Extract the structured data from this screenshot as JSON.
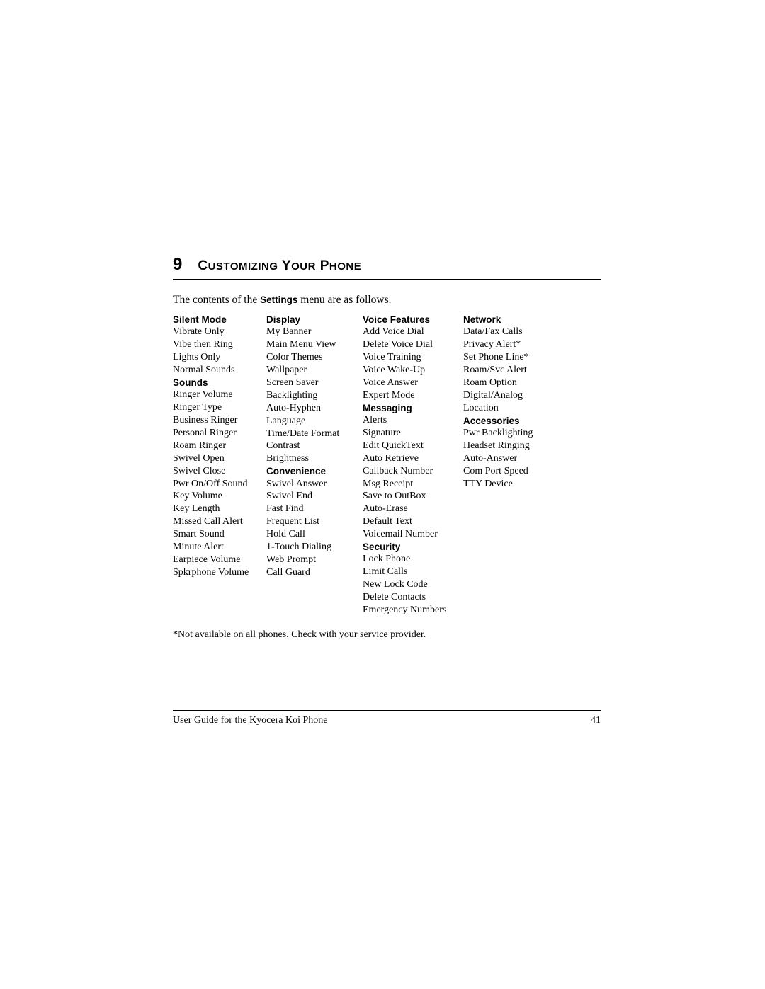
{
  "chapter": {
    "number": "9",
    "title_caps": [
      "C",
      "USTOMIZING",
      " Y",
      "OUR",
      " P",
      "HONE"
    ]
  },
  "intro": {
    "prefix": "The contents of the ",
    "bold": "Settings",
    "suffix": " menu are as follows."
  },
  "columns": [
    {
      "sections": [
        {
          "heading": "Silent Mode",
          "items": [
            "Vibrate Only",
            "Vibe then Ring",
            "Lights Only",
            "Normal Sounds"
          ]
        },
        {
          "heading": "Sounds",
          "items": [
            "Ringer Volume",
            "Ringer Type",
            "Business Ringer",
            "Personal Ringer",
            "Roam Ringer",
            "Swivel Open",
            "Swivel Close",
            "Pwr On/Off Sound",
            "Key Volume",
            "Key Length",
            "Missed Call Alert",
            "Smart Sound",
            "Minute Alert",
            "Earpiece Volume",
            "Spkrphone Volume"
          ]
        }
      ]
    },
    {
      "sections": [
        {
          "heading": "Display",
          "items": [
            "My Banner",
            "Main Menu View",
            "Color Themes",
            "Wallpaper",
            "Screen Saver",
            "Backlighting",
            "Auto-Hyphen",
            "Language",
            "Time/Date Format",
            "Contrast",
            "Brightness"
          ]
        },
        {
          "heading": "Convenience",
          "items": [
            "Swivel Answer",
            "Swivel End",
            "Fast Find",
            "Frequent List",
            "Hold Call",
            "1-Touch Dialing",
            "Web Prompt",
            "Call Guard"
          ]
        }
      ]
    },
    {
      "sections": [
        {
          "heading": "Voice Features",
          "items": [
            "Add Voice Dial",
            "Delete Voice Dial",
            "Voice Training",
            "Voice Wake-Up",
            "Voice Answer",
            "Expert Mode"
          ]
        },
        {
          "heading": "Messaging",
          "items": [
            "Alerts",
            "Signature",
            "Edit QuickText",
            "Auto Retrieve",
            "Callback Number",
            "Msg Receipt",
            "Save to OutBox",
            "Auto-Erase",
            "Default Text",
            "Voicemail Number"
          ]
        },
        {
          "heading": "Security",
          "items": [
            "Lock Phone",
            "Limit Calls",
            "New Lock Code",
            "Delete Contacts",
            "Emergency Numbers"
          ]
        }
      ]
    },
    {
      "sections": [
        {
          "heading": "Network",
          "items": [
            "Data/Fax Calls",
            "Privacy Alert*",
            "Set Phone Line*",
            "Roam/Svc Alert",
            "Roam Option",
            "Digital/Analog",
            "Location"
          ]
        },
        {
          "heading": "Accessories",
          "items": [
            "Pwr Backlighting",
            "Headset Ringing",
            "Auto-Answer",
            "Com Port Speed",
            "TTY Device"
          ]
        }
      ]
    }
  ],
  "footnote": "*Not available on all phones. Check with your service provider.",
  "footer": {
    "left": "User Guide for the Kyocera Koi Phone",
    "right": "41"
  }
}
